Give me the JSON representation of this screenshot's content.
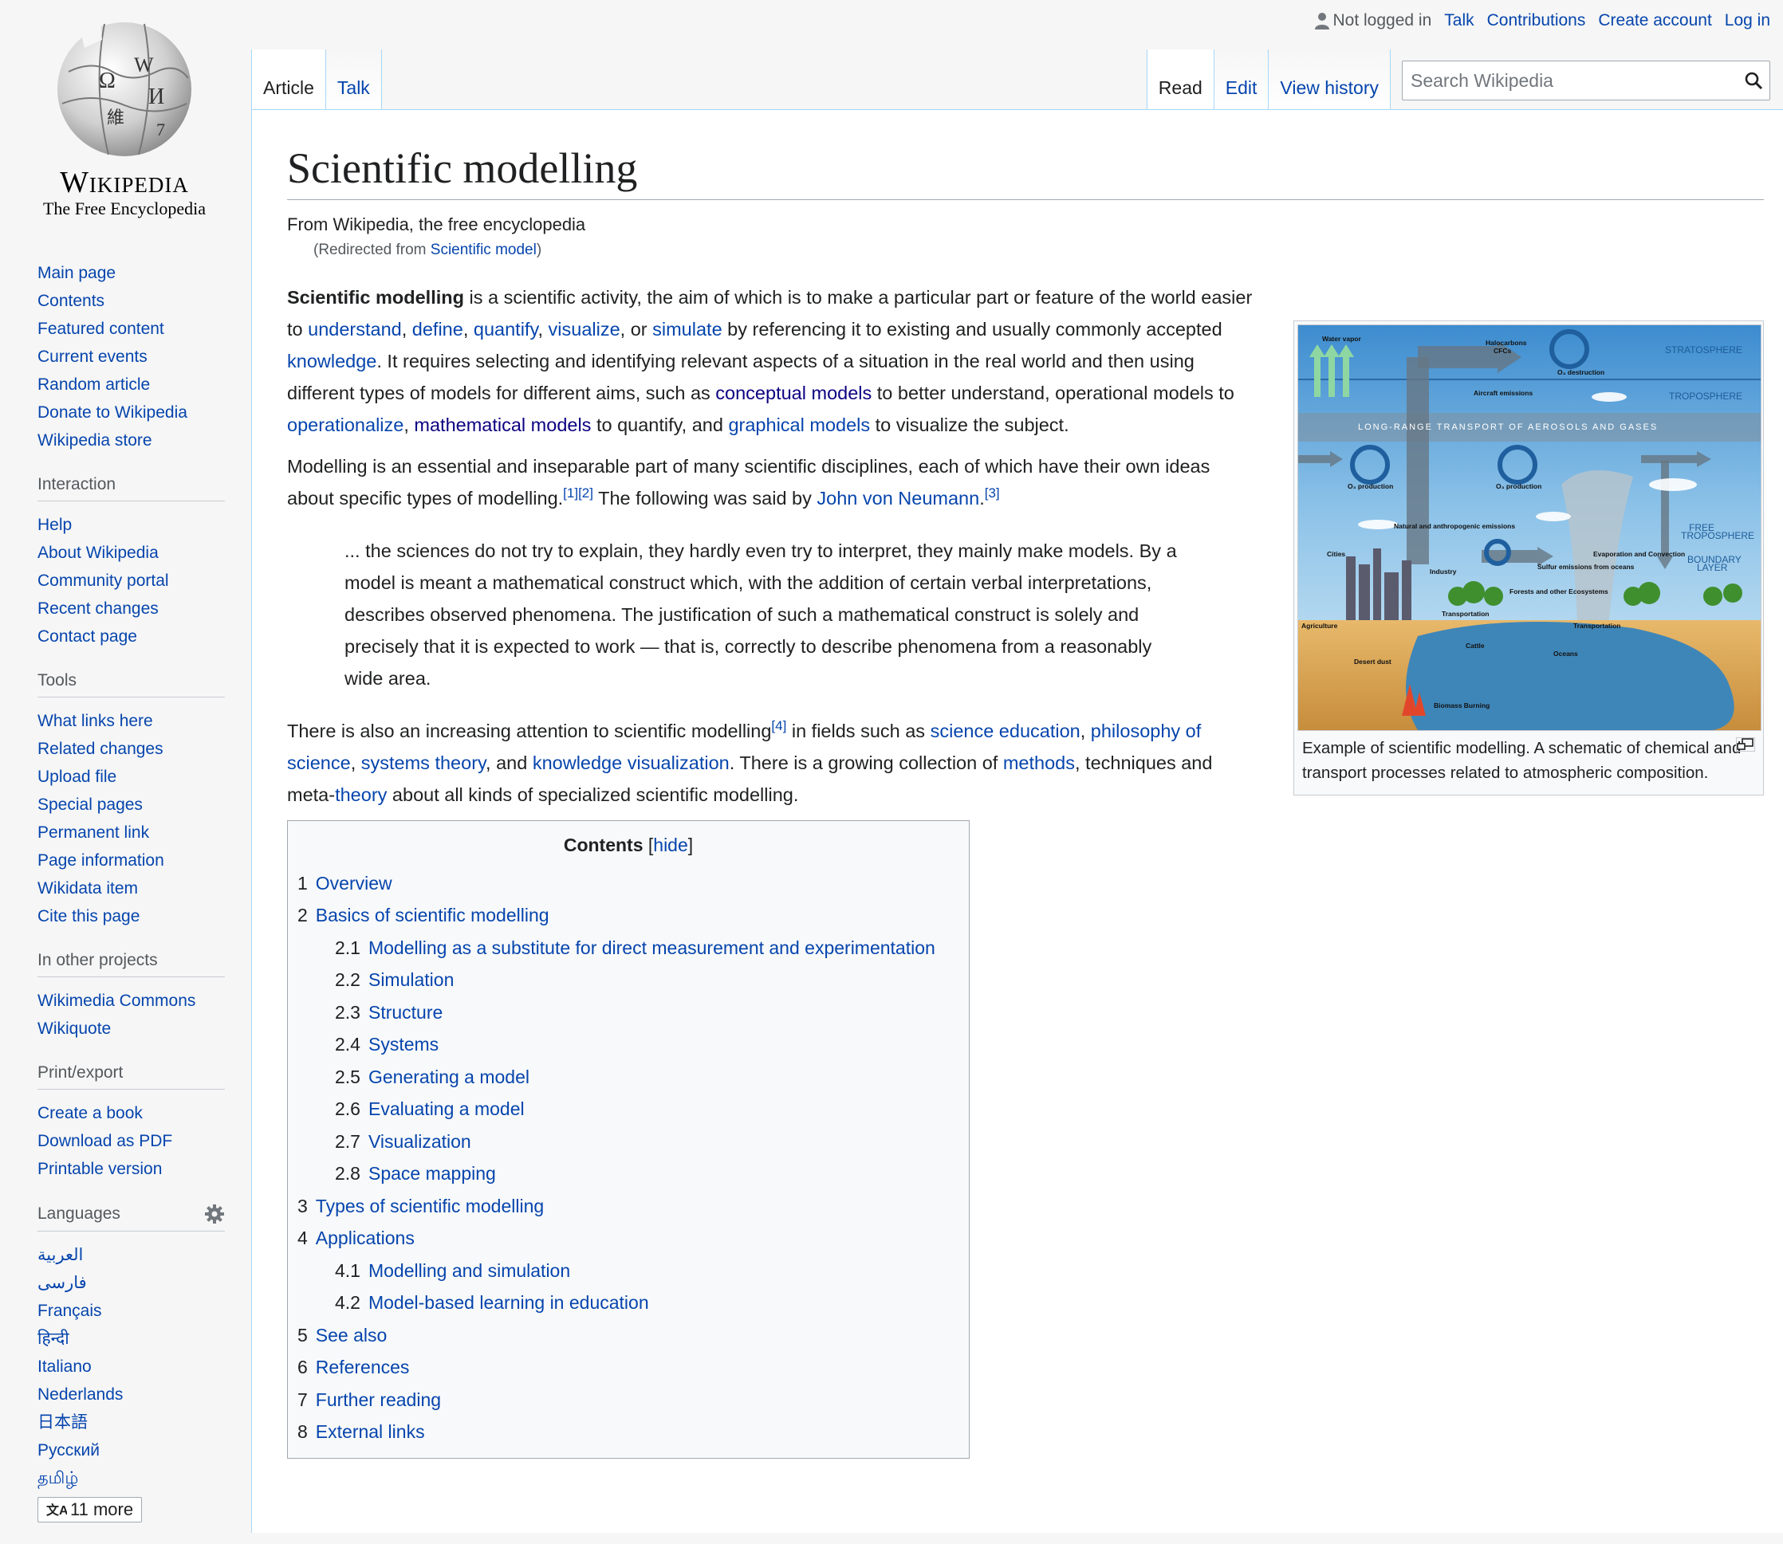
{
  "personal": {
    "not_logged_in": "Not logged in",
    "talk": "Talk",
    "contributions": "Contributions",
    "create_account": "Create account",
    "log_in": "Log in"
  },
  "logo": {
    "wordmark": "Wikipedia",
    "tagline": "The Free Encyclopedia"
  },
  "tabs": {
    "article": "Article",
    "talk": "Talk",
    "read": "Read",
    "edit": "Edit",
    "view_history": "View history"
  },
  "search": {
    "placeholder": "Search Wikipedia"
  },
  "sidebar": {
    "navigation": [
      "Main page",
      "Contents",
      "Featured content",
      "Current events",
      "Random article",
      "Donate to Wikipedia",
      "Wikipedia store"
    ],
    "interaction": {
      "heading": "Interaction",
      "items": [
        "Help",
        "About Wikipedia",
        "Community portal",
        "Recent changes",
        "Contact page"
      ]
    },
    "tools": {
      "heading": "Tools",
      "items": [
        "What links here",
        "Related changes",
        "Upload file",
        "Special pages",
        "Permanent link",
        "Page information",
        "Wikidata item",
        "Cite this page"
      ]
    },
    "other_projects": {
      "heading": "In other projects",
      "items": [
        "Wikimedia Commons",
        "Wikiquote"
      ]
    },
    "print": {
      "heading": "Print/export",
      "items": [
        "Create a book",
        "Download as PDF",
        "Printable version"
      ]
    },
    "languages": {
      "heading": "Languages",
      "items": [
        "العربية",
        "فارسی",
        "Français",
        "हिन्दी",
        "Italiano",
        "Nederlands",
        "日本語",
        "Русский",
        "தமிழ்"
      ],
      "more": "11 more"
    }
  },
  "article": {
    "title": "Scientific modelling",
    "site_sub": "From Wikipedia, the free encyclopedia",
    "redirect_prefix": "(Redirected from ",
    "redirect_link": "Scientific model",
    "redirect_suffix": ")",
    "p1": {
      "bold": "Scientific modelling",
      "t1": " is a scientific activity, the aim of which is to make a particular part or feature of the world easier to ",
      "l_understand": "understand",
      "c1": ", ",
      "l_define": "define",
      "c2": ", ",
      "l_quantify": "quantify",
      "c3": ", ",
      "l_visualize": "visualize",
      "t2": ", or ",
      "l_simulate": "simulate",
      "t3": " by referencing it to existing and usually commonly accepted ",
      "l_knowledge": "knowledge",
      "t4": ". It requires selecting and identifying relevant aspects of a situation in the real world and then using different types of models for different aims, such as ",
      "l_conceptual": "conceptual models",
      "t5": " to better understand, operational models to ",
      "l_operationalize": "operationalize",
      "c4": ", ",
      "l_mathematical": "mathematical models",
      "t6": " to quantify, and ",
      "l_graphical": "graphical models",
      "t7": " to visualize the subject."
    },
    "p2": {
      "t1": "Modelling is an essential and inseparable part of many scientific disciplines, each of which have their own ideas about specific types of modelling.",
      "ref1": "[1]",
      "ref2": "[2]",
      "t2": " The following was said by ",
      "l_neumann": "John von Neumann",
      "t3": ".",
      "ref3": "[3]"
    },
    "quote": "... the sciences do not try to explain, they hardly even try to interpret, they mainly make models. By a model is meant a mathematical construct which, with the addition of certain verbal interpretations, describes observed phenomena. The justification of such a mathematical construct is solely and precisely that it is expected to work — that is, correctly to describe phenomena from a reasonably wide area.",
    "p3": {
      "t1": "There is also an increasing attention to scientific modelling",
      "ref4": "[4]",
      "t2": " in fields such as ",
      "l_sci_ed": "science education",
      "c1": ", ",
      "l_philosophy": "philosophy of science",
      "c2": ", ",
      "l_systems": "systems theory",
      "t3": ", and ",
      "l_knowvis": "knowledge visualization",
      "t4": ". There is a growing collection of ",
      "l_methods": "methods",
      "t5": ", techniques and meta-",
      "l_theory": "theory",
      "t6": " about all kinds of specialized scientific modelling."
    }
  },
  "thumbnail": {
    "caption": "Example of scientific modelling. A schematic of chemical and transport processes related to atmospheric composition.",
    "labels": {
      "stratosphere": "STRATOSPHERE",
      "troposphere": "TROPOSPHERE",
      "long_range": "LONG-RANGE TRANSPORT OF AEROSOLS AND GASES",
      "free_trop_1": "FREE",
      "free_trop_2": "TROPOSPHERE",
      "boundary_1": "BOUNDARY",
      "boundary_2": "LAYER",
      "water_vapor": "Water vapor",
      "halocarbons": "Halocarbons",
      "cfcs": "CFCs",
      "o3_destruction": "O₃ destruction",
      "o3_production": "O₃ production",
      "aircraft": "Aircraft emissions",
      "cities": "Cities",
      "industry": "Industry",
      "agriculture": "Agriculture",
      "transportation": "Transportation",
      "oceans": "Oceans",
      "cattle": "Cattle",
      "desert_dust": "Desert dust",
      "biomass": "Biomass Burning",
      "forests": "Forests and other Ecosystems",
      "evaporation": "Evaporation and Convection",
      "sulfur": "Sulfur emissions from oceans",
      "natural": "Natural and anthropogenic emissions"
    }
  },
  "toc": {
    "title": "Contents",
    "hide_open": "[",
    "hide": "hide",
    "hide_close": "]",
    "items": [
      {
        "num": "1",
        "text": "Overview",
        "level": 1
      },
      {
        "num": "2",
        "text": "Basics of scientific modelling",
        "level": 1
      },
      {
        "num": "2.1",
        "text": "Modelling as a substitute for direct measurement and experimentation",
        "level": 2
      },
      {
        "num": "2.2",
        "text": "Simulation",
        "level": 2
      },
      {
        "num": "2.3",
        "text": "Structure",
        "level": 2
      },
      {
        "num": "2.4",
        "text": "Systems",
        "level": 2
      },
      {
        "num": "2.5",
        "text": "Generating a model",
        "level": 2
      },
      {
        "num": "2.6",
        "text": "Evaluating a model",
        "level": 2
      },
      {
        "num": "2.7",
        "text": "Visualization",
        "level": 2
      },
      {
        "num": "2.8",
        "text": "Space mapping",
        "level": 2
      },
      {
        "num": "3",
        "text": "Types of scientific modelling",
        "level": 1
      },
      {
        "num": "4",
        "text": "Applications",
        "level": 1
      },
      {
        "num": "4.1",
        "text": "Modelling and simulation",
        "level": 2
      },
      {
        "num": "4.2",
        "text": "Model-based learning in education",
        "level": 2
      },
      {
        "num": "5",
        "text": "See also",
        "level": 1
      },
      {
        "num": "6",
        "text": "References",
        "level": 1
      },
      {
        "num": "7",
        "text": "Further reading",
        "level": 1
      },
      {
        "num": "8",
        "text": "External links",
        "level": 1
      }
    ]
  }
}
